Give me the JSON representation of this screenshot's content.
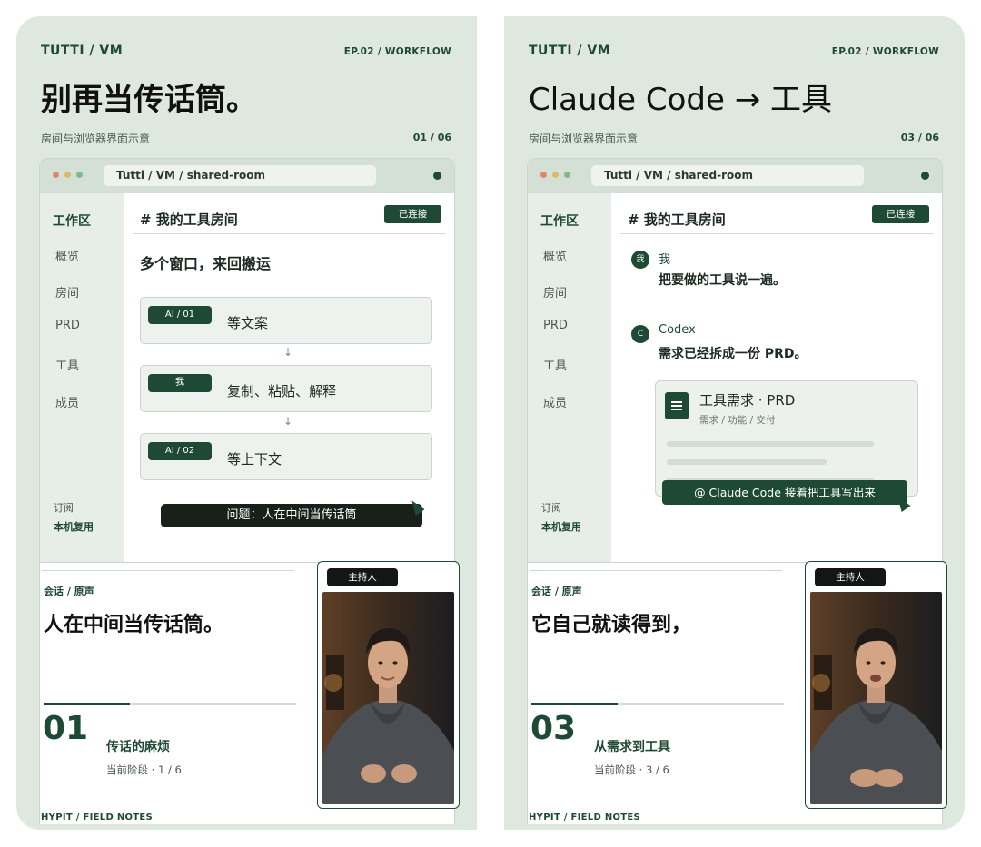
{
  "left": {
    "brand": "TUTTI / VM",
    "episode": "EP.02 / WORKFLOW",
    "title": "别再当传话筒。",
    "subtitle": "房间与浏览器界面示意",
    "page": "01 / 06",
    "browser": {
      "url": "Tutti / VM  /  shared-room",
      "room_title": "# 我的工具房间",
      "status": "已连接",
      "sidebar": [
        "工作区",
        "概览",
        "房间",
        "PRD",
        "工具",
        "成员"
      ],
      "sidebar_footer": [
        "订阅",
        "本机复用"
      ]
    },
    "lead": "多个窗口，来回搬运",
    "steps": [
      {
        "tag": "AI / 01",
        "label": "等文案"
      },
      {
        "tag": "我",
        "label": "复制、粘贴、解释"
      },
      {
        "tag": "AI / 02",
        "label": "等上下文"
      }
    ],
    "problem": "问题：人在中间当传话筒",
    "session_label": "会话 / 原声",
    "quote": "人在中间当传话筒。",
    "progress": 0.34,
    "stage_number": "01",
    "stage_name": "传话的麻烦",
    "stage_meta": "当前阶段 · 1 / 6",
    "host_tag": "主持人",
    "footer": "HYPIT / FIELD NOTES"
  },
  "right": {
    "brand": "TUTTI / VM",
    "episode": "EP.02 / WORKFLOW",
    "title": "Claude Code → 工具",
    "subtitle": "房间与浏览器界面示意",
    "page": "03 / 06",
    "browser": {
      "url": "Tutti / VM  /  shared-room",
      "room_title": "# 我的工具房间",
      "status": "已连接",
      "sidebar": [
        "工作区",
        "概览",
        "房间",
        "PRD",
        "工具",
        "成员"
      ],
      "sidebar_footer": [
        "订阅",
        "本机复用"
      ]
    },
    "messages": [
      {
        "avatar": "我",
        "name": "我",
        "text": "把要做的工具说一遍。"
      },
      {
        "avatar": "C",
        "name": "Codex",
        "text": "需求已经拆成一份 PRD。"
      }
    ],
    "prd_card": {
      "title": "工具需求 · PRD",
      "meta": "需求 / 功能 / 交付"
    },
    "cta": "@ Claude Code  接着把工具写出来",
    "session_label": "会话 / 原声",
    "quote": "它自己就读得到，",
    "progress": 0.34,
    "stage_number": "03",
    "stage_name": "从需求到工具",
    "stage_meta": "当前阶段 · 3 / 6",
    "host_tag": "主持人",
    "footer": "HYPIT / FIELD NOTES"
  },
  "colors": {
    "accent": "#1e4a35",
    "panel_bg": "#dfe8df",
    "dark": "#172019"
  }
}
